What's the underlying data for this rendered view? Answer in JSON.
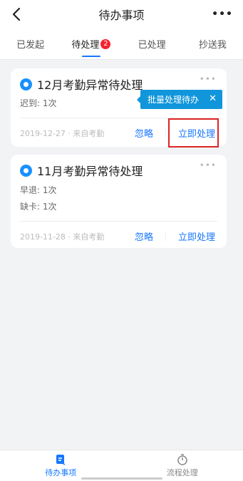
{
  "header": {
    "title": "待办事项",
    "more_icon": "more-icon"
  },
  "tabs": [
    {
      "label": "已发起"
    },
    {
      "label": "待处理",
      "badge": "2"
    },
    {
      "label": "已处理"
    },
    {
      "label": "抄送我"
    }
  ],
  "cards": [
    {
      "title": "12月考勤异常待处理",
      "details": [
        "迟到: 1次"
      ],
      "meta": "2019-12-27 · 来自考勤",
      "ignore_label": "忽略",
      "process_label": "立即处理"
    },
    {
      "title": "11月考勤异常待处理",
      "details": [
        "早退: 1次",
        "缺卡: 1次"
      ],
      "meta": "2019-11-28 · 来自考勤",
      "ignore_label": "忽略",
      "process_label": "立即处理"
    }
  ],
  "tooltip": {
    "text": "批量处理待办",
    "close": "✕"
  },
  "bottom_nav": [
    {
      "label": "待办事项",
      "icon": "todo-icon"
    },
    {
      "label": "流程处理",
      "icon": "flow-icon"
    }
  ],
  "colors": {
    "accent": "#1677ff",
    "badge": "#f5222d",
    "highlight_box": "#e02424"
  }
}
